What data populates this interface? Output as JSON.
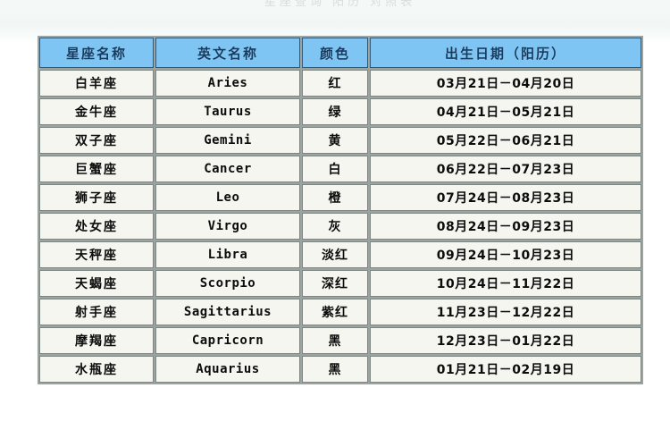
{
  "page": {
    "ghost_title": "星座查询 阳历 对照表"
  },
  "table": {
    "name": "zodiac-sign-reference-table",
    "headers": [
      "星座名称",
      "英文名称",
      "颜色",
      "出生日期（阳历）"
    ],
    "rows": [
      {
        "name": "白羊座",
        "english": "Aries",
        "color": "红",
        "date": "03月21日－04月20日"
      },
      {
        "name": "金牛座",
        "english": "Taurus",
        "color": "绿",
        "date": "04月21日－05月21日"
      },
      {
        "name": "双子座",
        "english": "Gemini",
        "color": "黄",
        "date": "05月22日－06月21日"
      },
      {
        "name": "巨蟹座",
        "english": "Cancer",
        "color": "白",
        "date": "06月22日－07月23日"
      },
      {
        "name": "狮子座",
        "english": "Leo",
        "color": "橙",
        "date": "07月24日－08月23日"
      },
      {
        "name": "处女座",
        "english": "Virgo",
        "color": "灰",
        "date": "08月24日－09月23日"
      },
      {
        "name": "天秤座",
        "english": "Libra",
        "color": "淡红",
        "date": "09月24日－10月23日"
      },
      {
        "name": "天蝎座",
        "english": "Scorpio",
        "color": "深红",
        "date": "10月24日－11月22日"
      },
      {
        "name": "射手座",
        "english": "Sagittarius",
        "color": "紫红",
        "date": "11月23日－12月22日"
      },
      {
        "name": "摩羯座",
        "english": "Capricorn",
        "color": "黑",
        "date": "12月23日－01月22日"
      },
      {
        "name": "水瓶座",
        "english": "Aquarius",
        "color": "黑",
        "date": "01月21日－02月19日"
      }
    ]
  },
  "colors": {
    "header_fill": "#7ec2ef",
    "header_border": "#2f5d80",
    "header_text": "#1b3f63",
    "cell_fill": "#f1f1ec",
    "cell_border": "#7e8784",
    "cell_text": "#101010",
    "grid_gap": "#9aa3a0",
    "page_background": "#ffffff"
  }
}
